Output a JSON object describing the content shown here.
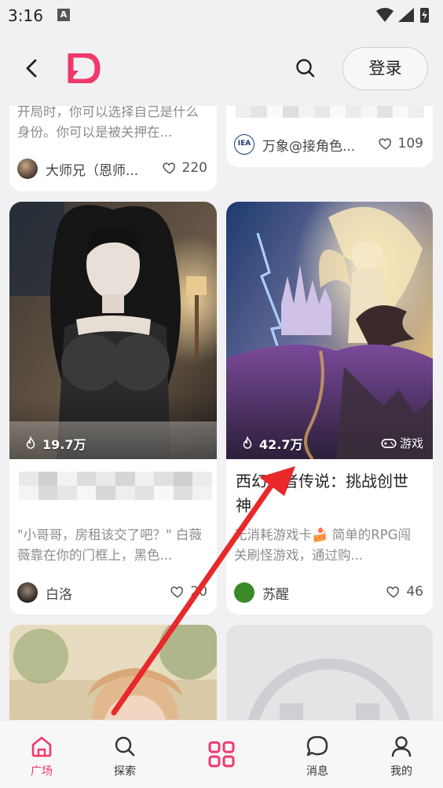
{
  "status": {
    "time": "3:16",
    "a_badge": "A"
  },
  "header": {
    "login_label": "登录"
  },
  "cards": {
    "top_left": {
      "desc_partial": "开局时，你可以选择自己是什么身份。你可以是被关押在...",
      "author": "大师兄（恩师...",
      "likes": "220"
    },
    "top_right": {
      "author": "万象@接角色...",
      "avatar_text": "IEA",
      "likes": "109"
    },
    "mid_left": {
      "hot": "19.7万",
      "title_partial": "",
      "desc": "\"小哥哥，房租该交了吧？\" 白薇薇靠在你的门框上，黑色...",
      "author": "白洛",
      "likes": "20"
    },
    "mid_right": {
      "hot": "42.7万",
      "tag": "游戏",
      "title": "西幻勇者传说：挑战创世神",
      "desc": "无消耗游戏卡🍰 简单的RPG闯关刷怪游戏，通过购...",
      "author": "苏醒",
      "likes": "46"
    }
  },
  "nav": {
    "items": [
      {
        "label": "广场",
        "active": true
      },
      {
        "label": "探索",
        "active": false
      },
      {
        "label": "",
        "active": false
      },
      {
        "label": "消息",
        "active": false
      },
      {
        "label": "我的",
        "active": false
      }
    ]
  },
  "colors": {
    "accent": "#f0386b",
    "annotation_arrow": "#e8282a"
  }
}
